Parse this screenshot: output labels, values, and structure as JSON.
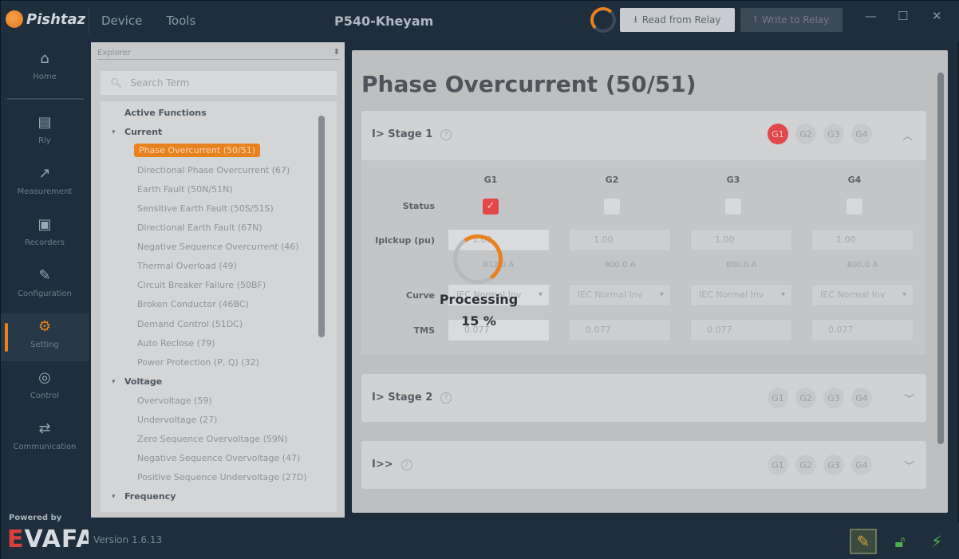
{
  "app": {
    "logo_text": "Pishtaz",
    "menu": [
      "Device",
      "Tools"
    ],
    "title": "P540-Kheyam",
    "read_button": "Read from Relay",
    "write_button": "Write to Relay",
    "window_controls": [
      "—",
      "☐",
      "✕"
    ]
  },
  "sidebar": {
    "items": [
      {
        "label": "Home",
        "icon": "home-icon"
      },
      {
        "label": "Rly",
        "icon": "relay-icon"
      },
      {
        "label": "Measurement",
        "icon": "measurement-icon"
      },
      {
        "label": "Recorders",
        "icon": "recorders-icon"
      },
      {
        "label": "Configuration",
        "icon": "configuration-icon"
      },
      {
        "label": "Setting",
        "icon": "setting-icon"
      },
      {
        "label": "Control",
        "icon": "control-icon"
      },
      {
        "label": "Communication",
        "icon": "communication-icon"
      }
    ],
    "powered_by": "Powered by",
    "brand": "EVAFA"
  },
  "footer": {
    "version": "Version 1.6.13"
  },
  "explorer": {
    "header": "Explorer",
    "search_placeholder": "Search Term",
    "active_functions": "Active Functions",
    "groups": {
      "current": "Current",
      "voltage": "Voltage",
      "frequency": "Frequency"
    },
    "current_items": [
      "Phase Overcurrent (50/51)",
      "Directional Phase Overcurrent (67)",
      "Earth Fault (50N/51N)",
      "Sensitive Earth Fault (50S/51S)",
      "Directional Earth Fault (67N)",
      "Negative Sequence Overcurrent (46)",
      "Thermal Overload (49)",
      "Circuit Breaker Failure (50BF)",
      "Broken Conductor (46BC)",
      "Demand Control (51DC)",
      "Auto Reclose (79)",
      "Power Protection (P, Q) (32)"
    ],
    "voltage_items": [
      "Overvoltage (59)",
      "Undervoltage (27)",
      "Zero Sequence Overvoltage (59N)",
      "Negative Sequence Overvoltage (47)",
      "Positive Sequence Undervoltage (27D)"
    ]
  },
  "main": {
    "title": "Phase Overcurrent (50/51)",
    "stages": [
      {
        "label": "I> Stage 1",
        "groups": [
          "G1",
          "G2",
          "G3",
          "G4"
        ],
        "active_group": "G1"
      },
      {
        "label": "I> Stage 2",
        "groups": [
          "G1",
          "G2",
          "G3",
          "G4"
        ]
      },
      {
        "label": "I>>",
        "groups": [
          "G1",
          "G2",
          "G3",
          "G4"
        ]
      }
    ],
    "table": {
      "columns": [
        "G1",
        "G2",
        "G3",
        "G4"
      ],
      "status_label": "Status",
      "status": [
        true,
        false,
        false,
        false
      ],
      "ipickup_label": "Ipickup (pu)",
      "ipickup": [
        "1.00",
        "1.00",
        "1.00",
        "1.00"
      ],
      "ipickup_sub": [
        "812.0 A",
        "800.0 A",
        "800.0 A",
        "800.0 A"
      ],
      "curve_label": "Curve",
      "curve": [
        "IEC Normal Inv",
        "IEC Normal Inv",
        "IEC Normal Inv",
        "IEC Normal Inv"
      ],
      "tms_label": "TMS",
      "tms": [
        "0.077",
        "0.077",
        "0.077",
        "0.077"
      ]
    }
  },
  "processing": {
    "label": "Processing",
    "percent": "15 %",
    "progress": 0.15
  }
}
